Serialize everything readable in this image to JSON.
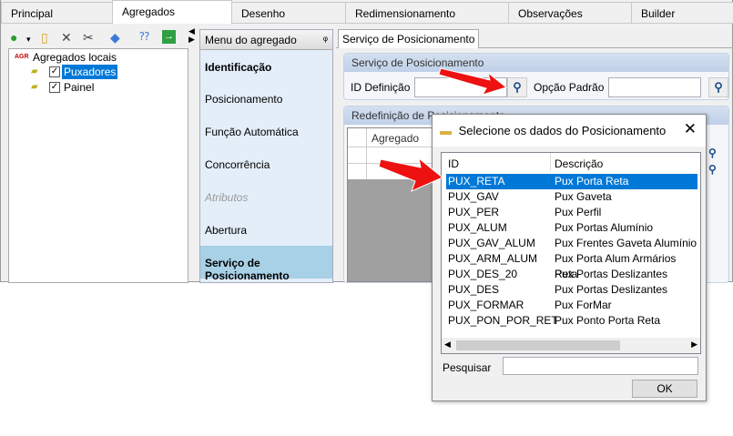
{
  "tabs": [
    "Principal",
    "Agregados",
    "Desenho",
    "Redimensionamento",
    "Observações",
    "Builder"
  ],
  "tree": {
    "root": "Agregados locais",
    "root_badge": "AGR",
    "items": [
      {
        "label": "Puxadores",
        "checked": true,
        "selected": true
      },
      {
        "label": "Painel",
        "checked": true
      }
    ]
  },
  "menu": {
    "title": "Menu do agregado",
    "pin": "ᵠ",
    "items": [
      "Identificação",
      "Posicionamento",
      "Função Automática",
      "Concorrência",
      "Atributos",
      "Abertura",
      "Serviço de Posicionamento"
    ]
  },
  "content": {
    "tab": "Serviço de Posicionamento",
    "group1": "Serviço de Posicionamento",
    "id_label": "ID Definição",
    "id_value": "",
    "opcao_label": "Opção Padrão",
    "opcao_value": "",
    "group2": "Redefinição de Posicionamento",
    "grid_col": "Agregado"
  },
  "dialog": {
    "title": "Selecione os dados do Posicionamento",
    "col_id": "ID",
    "col_desc": "Descrição",
    "rows": [
      [
        "PUX_RETA",
        "Pux Porta Reta"
      ],
      [
        "PUX_GAV",
        "Pux Gaveta"
      ],
      [
        "PUX_PER",
        "Pux Perfil"
      ],
      [
        "PUX_ALUM",
        "Pux Portas Alumínio"
      ],
      [
        "PUX_GAV_ALUM",
        "Pux Frentes Gaveta Alumínio"
      ],
      [
        "PUX_ARM_ALUM",
        "Pux Porta Alum Armários Reta"
      ],
      [
        "PUX_DES_20",
        "Pux Portas Deslizantes"
      ],
      [
        "PUX_DES",
        "Pux Portas Deslizantes"
      ],
      [
        "PUX_FORMAR",
        "Pux ForMar"
      ],
      [
        "PUX_PON_POR_RET",
        "Pux Ponto Porta Reta"
      ]
    ],
    "selected_row": 0,
    "search_label": "Pesquisar",
    "search_value": "",
    "ok": "OK"
  },
  "colors": {
    "selection": "#0078d7",
    "annotation_arrow": "#ee1111"
  }
}
